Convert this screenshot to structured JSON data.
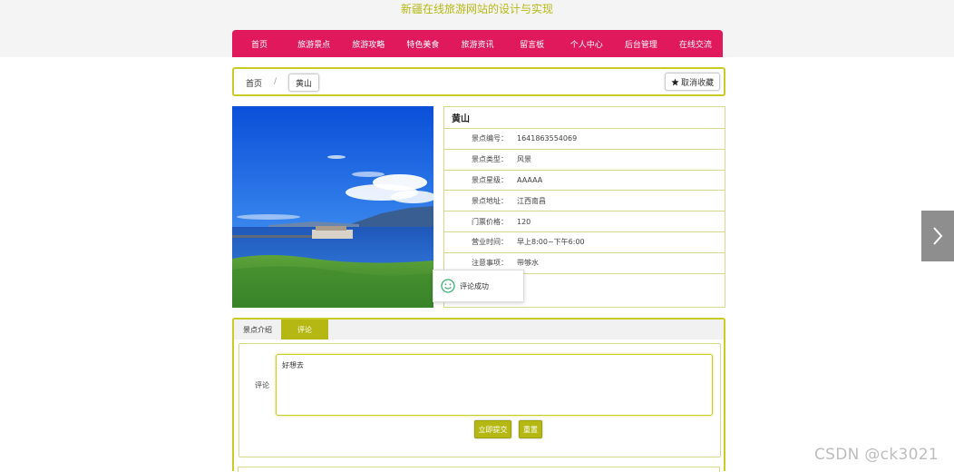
{
  "site": {
    "title": "新疆在线旅游网站的设计与实现"
  },
  "nav": {
    "items": [
      "首页",
      "旅游景点",
      "旅游攻略",
      "特色美食",
      "旅游资讯",
      "留言板",
      "个人中心",
      "后台管理",
      "在线交流"
    ]
  },
  "breadcrumb": {
    "home": "首页",
    "sep": "/",
    "current": "黄山"
  },
  "favorite": {
    "icon": "star-icon",
    "label": "取消收藏"
  },
  "spot": {
    "name": "黄山",
    "rows": [
      {
        "label": "景点编号：",
        "value": "1641863554069"
      },
      {
        "label": "景点类型：",
        "value": "风景"
      },
      {
        "label": "景点星级：",
        "value": "AAAAA"
      },
      {
        "label": "景点地址：",
        "value": "江西南昌"
      },
      {
        "label": "门票价格：",
        "value": "120"
      },
      {
        "label": "营业时间：",
        "value": "早上8:00~下午6:00"
      },
      {
        "label": "注意事项：",
        "value": "带够水"
      }
    ]
  },
  "toast": {
    "icon": "smile-icon",
    "text": "评论成功"
  },
  "tabs": [
    {
      "label": "景点介绍"
    },
    {
      "label": "评论"
    }
  ],
  "comment": {
    "label": "评论",
    "value": "好想去",
    "submit": "立即提交",
    "reset": "重置"
  },
  "colors": {
    "nav": "#e0195c",
    "accent": "#b5b812",
    "border": "#c9cc24"
  },
  "watermark": "CSDN @ck3021"
}
